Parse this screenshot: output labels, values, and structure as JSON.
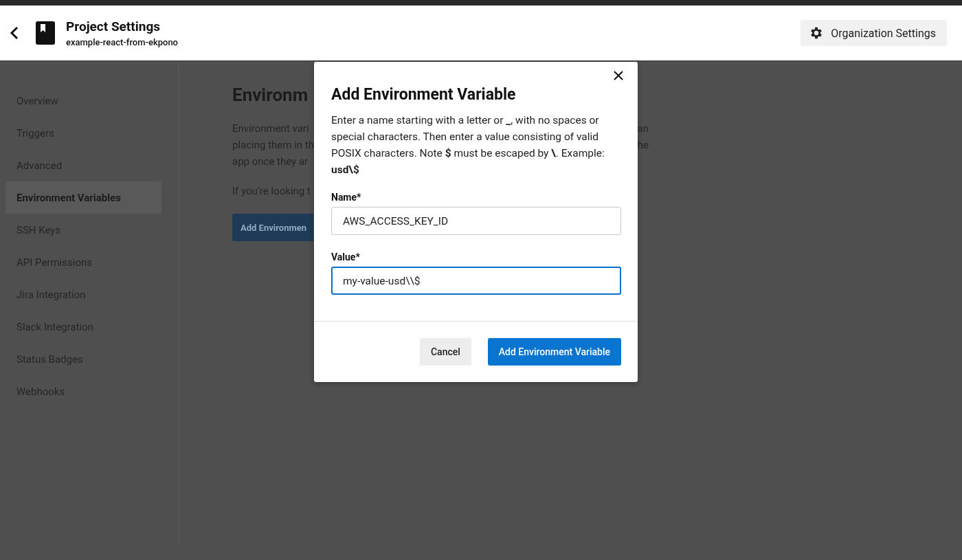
{
  "header": {
    "title": "Project Settings",
    "subtitle": "example-react-from-ekpono",
    "org_button": "Organization Settings"
  },
  "sidebar": {
    "items": [
      {
        "label": "Overview",
        "selected": false
      },
      {
        "label": "Triggers",
        "selected": false
      },
      {
        "label": "Advanced",
        "selected": false
      },
      {
        "label": "Environment Variables",
        "selected": true
      },
      {
        "label": "SSH Keys",
        "selected": false
      },
      {
        "label": "API Permissions",
        "selected": false
      },
      {
        "label": "Jira Integration",
        "selected": false
      },
      {
        "label": "Slack Integration",
        "selected": false
      },
      {
        "label": "Status Badges",
        "selected": false
      },
      {
        "label": "Webhooks",
        "selected": false
      }
    ]
  },
  "page": {
    "heading": "Environm",
    "lines": [
      {
        "left": "Environment vari",
        "right": "an"
      },
      {
        "left": "placing them in th",
        "right": "he"
      },
      {
        "left": "app once they ar"
      }
    ],
    "note": "If you’re looking t",
    "button": "Add Environmen"
  },
  "dialog": {
    "title": "Add Environment Variable",
    "description": "Enter a name starting with a letter or **_**, with no spaces or special characters. Then enter a value consisting of valid POSIX characters. Note **$** must be escaped by **\\**. Example: **usd\\$**",
    "fields": [
      {
        "label": "Name*",
        "value": "AWS_ACCESS_KEY_ID",
        "focused": false
      },
      {
        "label": "Value*",
        "value": "my-value-usd\\\\$",
        "focused": true
      }
    ],
    "cancel": "Cancel",
    "submit": "Add Environment Variable"
  }
}
